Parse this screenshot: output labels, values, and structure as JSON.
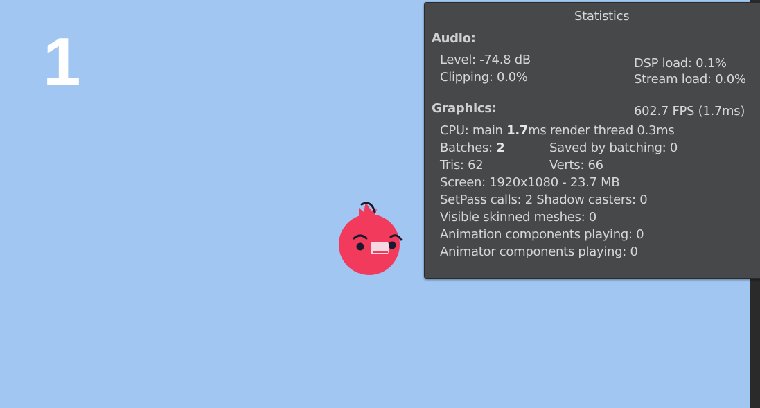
{
  "score": "1",
  "stats": {
    "title": "Statistics",
    "audio": {
      "header": "Audio:",
      "level": "Level: -74.8 dB",
      "clipping": "Clipping: 0.0%",
      "dsp_load": "DSP load: 0.1%",
      "stream_load": "Stream load: 0.0%"
    },
    "graphics": {
      "header": "Graphics:",
      "fps": "602.7 FPS (1.7ms)",
      "cpu_prefix": "CPU: main ",
      "cpu_main": "1.7",
      "cpu_suffix": "ms  render thread 0.3ms",
      "batches_prefix": "Batches: ",
      "batches_value": "2",
      "saved_by_batching": "Saved by batching: 0",
      "tris": "Tris: 62",
      "verts": "Verts: 66",
      "screen": "Screen: 1920x1080 - 23.7 MB",
      "setpass": "SetPass calls: 2 Shadow casters: 0",
      "skinned": "Visible skinned meshes: 0",
      "animation": "Animation components playing: 0",
      "animator": "Animator components playing: 0"
    }
  },
  "colors": {
    "sky": "#a1c6f2",
    "bird_body": "#f23a5c",
    "panel_bg": "#474849",
    "panel_text": "#d6d6d6"
  }
}
